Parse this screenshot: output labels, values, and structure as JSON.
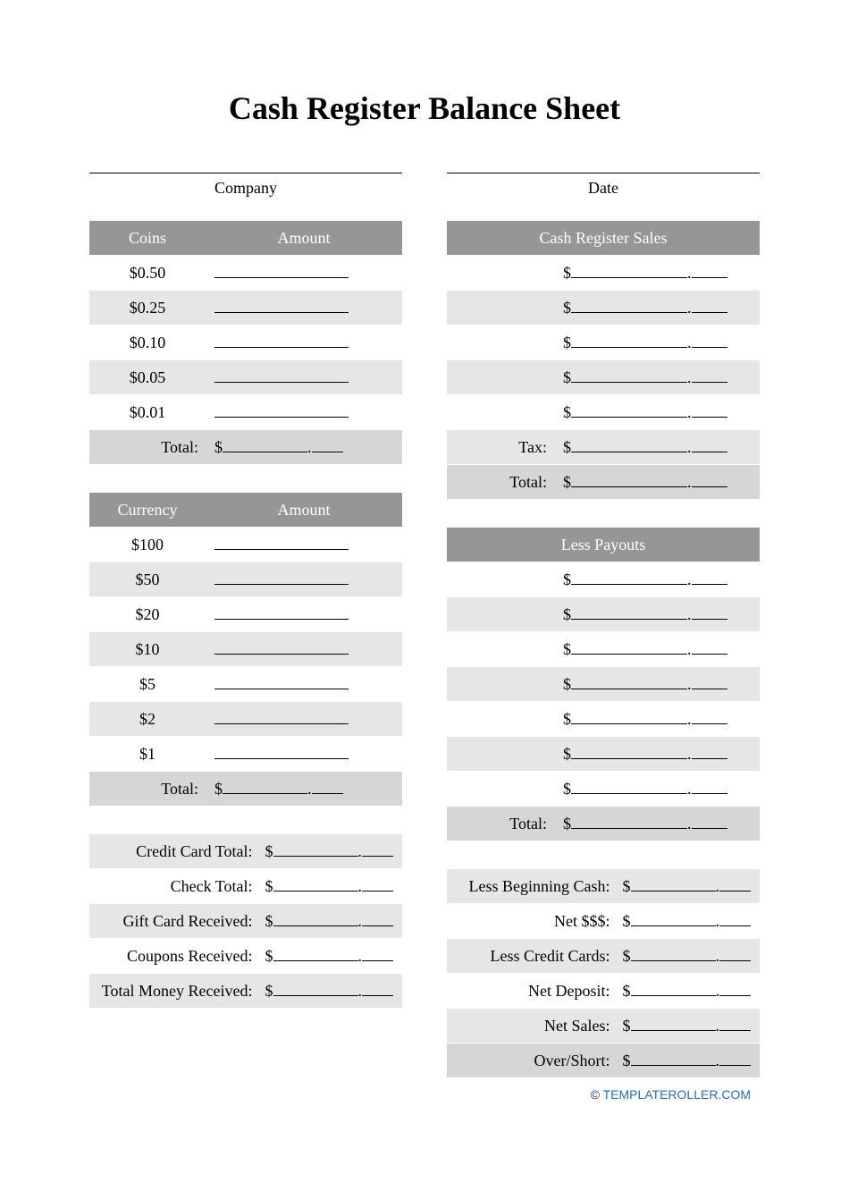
{
  "title": "Cash Register Balance Sheet",
  "header": {
    "company": "Company",
    "date": "Date"
  },
  "coins": {
    "header_left": "Coins",
    "header_right": "Amount",
    "rows": [
      "$0.50",
      "$0.25",
      "$0.10",
      "$0.05",
      "$0.01"
    ],
    "total_label": "Total:"
  },
  "currency": {
    "header_left": "Currency",
    "header_right": "Amount",
    "rows": [
      "$100",
      "$50",
      "$20",
      "$10",
      "$5",
      "$2",
      "$1"
    ],
    "total_label": "Total:"
  },
  "sales": {
    "header": "Cash Register Sales",
    "tax_label": "Tax:",
    "total_label": "Total:"
  },
  "payouts": {
    "header": "Less Payouts",
    "total_label": "Total:"
  },
  "left_summary": {
    "r0": "Credit Card Total:",
    "r1": "Check Total:",
    "r2": "Gift Card Received:",
    "r3": "Coupons Received:",
    "r4": "Total Money Received:"
  },
  "right_summary": {
    "r0": "Less Beginning Cash:",
    "r1": "Net $$$:",
    "r2": "Less Credit Cards:",
    "r3": "Net Deposit:",
    "r4": "Net Sales:",
    "r5": "Over/Short:"
  },
  "footer": {
    "copy": "©",
    "link": "TEMPLATEROLLER.COM"
  },
  "sym": {
    "dollar": "$",
    "dot": "."
  }
}
